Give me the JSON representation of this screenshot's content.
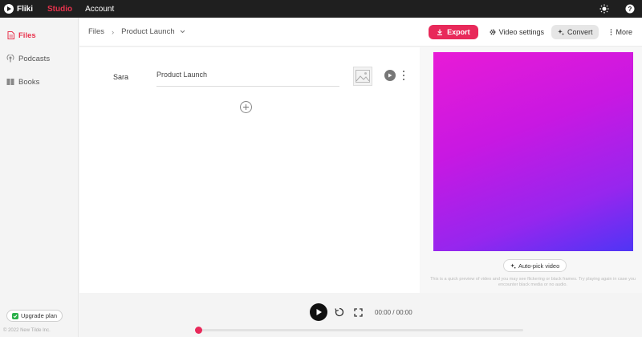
{
  "app": {
    "brand": "Fliki",
    "nav": {
      "studio": "Studio",
      "account": "Account"
    },
    "accent": "#e8334d"
  },
  "sidebar": {
    "items": [
      {
        "label": "Files",
        "icon": "file-icon",
        "active": true
      },
      {
        "label": "Podcasts",
        "icon": "podcast-icon",
        "active": false
      },
      {
        "label": "Books",
        "icon": "book-icon",
        "active": false
      }
    ],
    "upgrade_label": "Upgrade plan",
    "copyright": "© 2022 New Tilde Inc."
  },
  "header": {
    "breadcrumb": {
      "root": "Files",
      "current": "Product Launch"
    },
    "export_label": "Export",
    "video_settings_label": "Video settings",
    "convert_label": "Convert",
    "more_label": "More"
  },
  "editor": {
    "speaker": "Sara",
    "line_text": "Product Launch"
  },
  "preview": {
    "autopick_label": "Auto-pick video",
    "note": "This is a quick preview of video and you may see flickering or black frames. Try playing again in case you encounter black media or no audio.",
    "gradient_colors": [
      "#e81bd6",
      "#9626ee",
      "#4f35f5"
    ]
  },
  "player": {
    "time": "00:00 / 00:00",
    "progress": 0
  }
}
